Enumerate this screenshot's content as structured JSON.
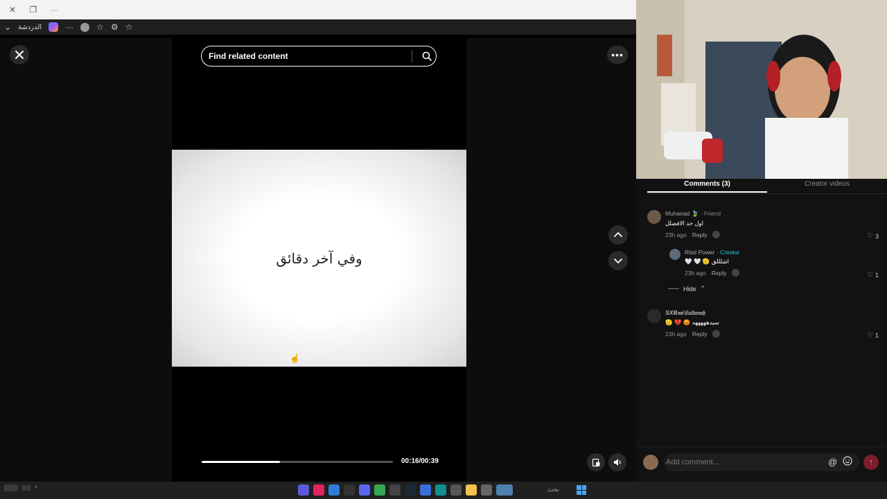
{
  "browser": {
    "chat_label": "الدردشة",
    "more_glyph": "···"
  },
  "viewer": {
    "search_text": "Find related content",
    "caption": "وفي آخر دقائق",
    "progress": 0.41,
    "time": "00:16/00:39"
  },
  "comments_panel": {
    "tabs": [
      {
        "label": "Comments (3)",
        "active": true
      },
      {
        "label": "Creator videos",
        "active": false
      }
    ],
    "comments": [
      {
        "name": "Muhanad",
        "badge": "🍃",
        "tag": "· Friend",
        "text": "اول حد الافضلل",
        "time": "23h ago",
        "reply": "Reply",
        "likes": "3"
      },
      {
        "name": "Rital Power",
        "tag": "· Creator",
        "text": "🤍 🤍 🫡 اشلللق",
        "time": "23h ago",
        "reply": "Reply",
        "likes": "1"
      },
      {
        "name": "SXB𝔰𝔞/𝔖𝔲𝔩𝔱𝔞𝔫𝔞𝔥",
        "text": "🫡 💔 😡 سيدهههههه",
        "time": "23h ago",
        "reply": "Reply",
        "likes": "1"
      }
    ],
    "hide_label": "Hide",
    "add_comment_placeholder": "Add comment...",
    "at_symbol": "@"
  },
  "taskbar": {
    "search_label": "بحث"
  },
  "colors": {
    "creator_tag": "#25c5e6",
    "send_button": "#7a1d2d",
    "panel_bg": "#121212"
  }
}
